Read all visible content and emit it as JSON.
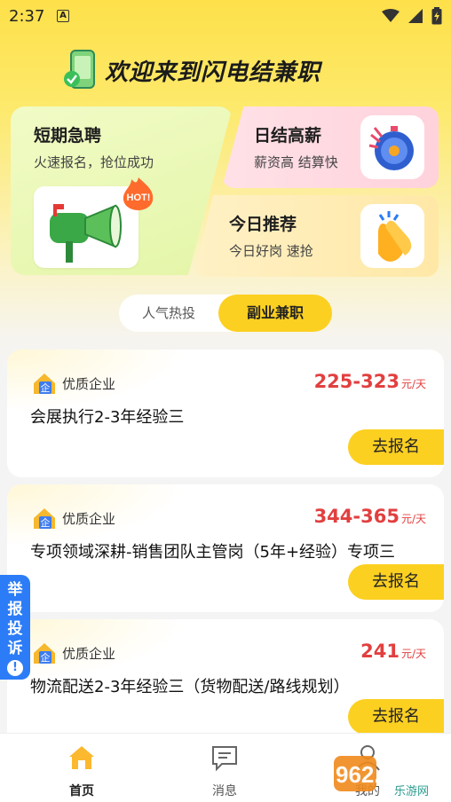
{
  "status_bar": {
    "time": "2:37",
    "notif_letter": "A"
  },
  "header": {
    "title": "欢迎来到闪电结兼职"
  },
  "features": {
    "big": {
      "title": "短期急聘",
      "subtitle": "火速报名，抢位成功",
      "badge": "HOT!"
    },
    "right_top": {
      "title": "日结高薪",
      "subtitle": "薪资高 结算快"
    },
    "right_bottom": {
      "title": "今日推荐",
      "subtitle": "今日好岗 速抢"
    }
  },
  "tabs": [
    {
      "label": "人气热投",
      "active": false
    },
    {
      "label": "副业兼职",
      "active": true
    }
  ],
  "jobs": [
    {
      "badge": "优质企业",
      "salary": "225-323",
      "unit": "元/天",
      "title": "会展执行2-3年经验三",
      "action": "去报名"
    },
    {
      "badge": "优质企业",
      "salary": "344-365",
      "unit": "元/天",
      "title": "专项领域深耕-销售团队主管岗（5年+经验）专项三",
      "action": "去报名"
    },
    {
      "badge": "优质企业",
      "salary": "241",
      "unit": "元/天",
      "title": "物流配送2-3年经验三（货物配送/路线规划）",
      "action": "去报名"
    }
  ],
  "report": {
    "label_chars": [
      "举",
      "报",
      "投",
      "诉"
    ],
    "alert": "!"
  },
  "bottom_nav": [
    {
      "label": "首页",
      "active": true
    },
    {
      "label": "消息",
      "active": false
    },
    {
      "label": "我的",
      "active": false
    }
  ],
  "watermark": {
    "brand": "962.NET",
    "site": "乐游网"
  },
  "colors": {
    "accent": "#fcd021",
    "salary": "#e23f3f",
    "report": "#2b7cf6",
    "badge_blue": "#3d7cf0"
  }
}
